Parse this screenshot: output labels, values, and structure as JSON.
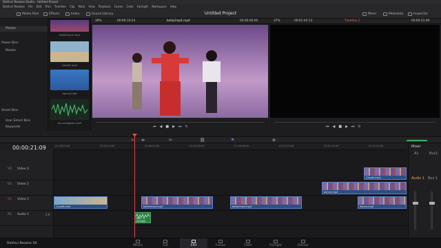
{
  "window": {
    "title": "DaVinci Resolve Studio - Untitled Project"
  },
  "menu": [
    "DaVinci Resolve",
    "File",
    "Edit",
    "Trim",
    "Timeline",
    "Clip",
    "Mark",
    "View",
    "Playback",
    "Fusion",
    "Color",
    "Fairlight",
    "Workspace",
    "Help"
  ],
  "toolbar": {
    "media_pool": "Media Pool",
    "effects": "Effects",
    "index": "Index",
    "sound_library": "Sound Library",
    "project_title": "Untitled Project",
    "mixer": "Mixer",
    "metadata": "Metadata",
    "inspector": "Inspector"
  },
  "media_pool": {
    "master": "Master",
    "power_bins": "Power Bins",
    "power_master": "Master",
    "smart_bins": "Smart Bins",
    "user_smart_bins": "User Smart Bins",
    "keywords": "Keywords",
    "clips": [
      {
        "name": "balla2mp4.mp4",
        "color": "#6a4f8e"
      },
      {
        "name": "Cavalli.mp4",
        "color": "#6f9fc0"
      },
      {
        "name": "dance.mp4",
        "color": "#3a6fb0"
      },
      {
        "name": "mx-navigator.mp3",
        "color": "#1f3d2a"
      }
    ]
  },
  "source_viewer": {
    "zoom": "39%",
    "tc_left": "00:00:10:24",
    "clip_name": "balla2mp4.mp4",
    "tc_right": "00:00:00:00"
  },
  "timeline_viewer": {
    "zoom": "37%",
    "tc_left": "00:01:45:13",
    "timeline_name": "Timeline 1",
    "tc_right": "00:00:21:09"
  },
  "timeline": {
    "timecode": "00:00:21:09",
    "ruler_ticks": [
      "01:00:00:00",
      "01:00:12:00",
      "01:00:24:00",
      "01:00:36:00",
      "01:00:48:00",
      "01:01:00:00",
      "01:01:12:00",
      "01:01:24:00"
    ],
    "tracks": {
      "v3": {
        "id": "V3",
        "name": "Video 3"
      },
      "v2": {
        "id": "V2",
        "name": "Video 2"
      },
      "v1": {
        "id": "V1",
        "name": "Video 1"
      },
      "a1": {
        "id": "A1",
        "name": "Audio 1",
        "level": "2.0"
      }
    },
    "clips": {
      "v3_cavalli": "Cavalli.mp4",
      "v2_dance": "dance.mp4",
      "v1_cavalli": "Cavalli.mp4",
      "v1_balla_a": "balla2mp4.mp4",
      "v1_balla_b": "balla2mp4.mp4",
      "v1_dance": "dance.mp4",
      "a1_mx": "mx-navigat"
    }
  },
  "mixer": {
    "title": "Mixer",
    "a1": "A1",
    "bus1": "Bus1",
    "audio1": "Audio 1",
    "bus1b": "Bus 1"
  },
  "pages": [
    "Media",
    "Cut",
    "Edit",
    "Fusion",
    "Color",
    "Fairlight",
    "Deliver"
  ],
  "active_page": "Edit",
  "footer": {
    "app": "DaVinci Resolve 18"
  }
}
